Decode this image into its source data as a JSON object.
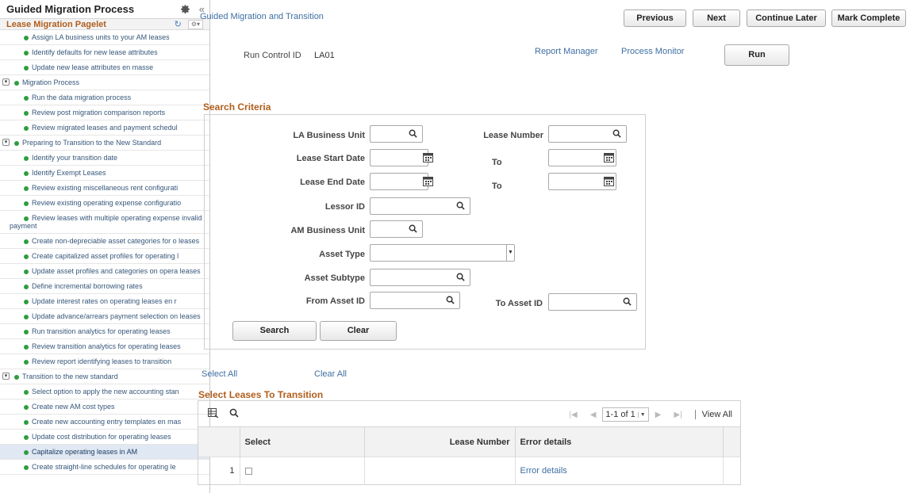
{
  "sidebar": {
    "title": "Guided Migration Process",
    "pagelet_title": "Lease Migration Pagelet",
    "items": [
      {
        "label": "Assign LA business units to your AM leases",
        "type": "step"
      },
      {
        "label": "Identify defaults for new lease attributes",
        "type": "step"
      },
      {
        "label": "Update new lease attributes en masse",
        "type": "step"
      },
      {
        "label": "Migration Process",
        "type": "section"
      },
      {
        "label": "Run the data migration process",
        "type": "step"
      },
      {
        "label": "Review post migration comparison reports",
        "type": "step"
      },
      {
        "label": "Review migrated leases and payment schedul",
        "type": "step"
      },
      {
        "label": "Preparing to Transition to the New Standard",
        "type": "section"
      },
      {
        "label": "Identify your transition date",
        "type": "step"
      },
      {
        "label": "Identify Exempt Leases",
        "type": "step"
      },
      {
        "label": "Review existing miscellaneous rent configurati",
        "type": "step"
      },
      {
        "label": "Review existing operating expense configuratio",
        "type": "step"
      },
      {
        "label": "Review leases with multiple operating expense invalid payment",
        "type": "wrap"
      },
      {
        "label": "Create non-depreciable asset categories for o leases",
        "type": "wrap"
      },
      {
        "label": "Create capitalized asset profiles for operating l",
        "type": "step"
      },
      {
        "label": "Update asset profiles and categories on opera leases",
        "type": "wrap"
      },
      {
        "label": "Define incremental borrowing rates",
        "type": "step"
      },
      {
        "label": "Update interest rates on operating leases en r",
        "type": "step"
      },
      {
        "label": "Update advance/arrears payment selection on leases",
        "type": "wrap"
      },
      {
        "label": "Run transition analytics for operating leases",
        "type": "step"
      },
      {
        "label": "Review transition analytics for operating leases",
        "type": "step"
      },
      {
        "label": "Review report identifying leases to transition",
        "type": "step"
      },
      {
        "label": "Transition to the new standard",
        "type": "section"
      },
      {
        "label": "Select option to apply the new accounting stan",
        "type": "step"
      },
      {
        "label": "Create new AM cost types",
        "type": "step"
      },
      {
        "label": "Create new accounting entry templates en mas",
        "type": "step"
      },
      {
        "label": "Update cost distribution for operating leases",
        "type": "step"
      },
      {
        "label": "Capitalize operating leases in AM",
        "type": "active"
      },
      {
        "label": "Create straight-line schedules for operating le",
        "type": "step"
      }
    ]
  },
  "header": {
    "title": "Guided Migration and Transition",
    "buttons": {
      "previous": "Previous",
      "next": "Next",
      "continue_later": "Continue Later",
      "mark_complete": "Mark Complete"
    }
  },
  "run_control": {
    "label": "Run Control ID",
    "value": "LA01",
    "report_manager": "Report Manager",
    "process_monitor": "Process Monitor",
    "run": "Run"
  },
  "search": {
    "title": "Search Criteria",
    "la_business_unit": "LA Business Unit",
    "lease_number": "Lease Number",
    "lease_start_date": "Lease Start Date",
    "lease_end_date": "Lease End Date",
    "to": "To",
    "lessor_id": "Lessor ID",
    "am_business_unit": "AM Business Unit",
    "asset_type": "Asset Type",
    "asset_subtype": "Asset Subtype",
    "from_asset_id": "From Asset ID",
    "to_asset_id": "To Asset ID",
    "search_button": "Search",
    "clear_button": "Clear"
  },
  "selection": {
    "select_all": "Select All",
    "clear_all": "Clear All",
    "grid_title": "Select Leases To Transition"
  },
  "grid": {
    "pager": "1-1 of 1",
    "view_all": "View All",
    "columns": {
      "select": "Select",
      "lease_number": "Lease Number",
      "error_details": "Error details"
    },
    "rows": [
      {
        "num": "1",
        "lease_number": "",
        "error_details": "Error details"
      }
    ]
  },
  "colors": {
    "link": "#3e6fa3",
    "section_orange": "#b05e1c",
    "status_green": "#2e9d3f"
  }
}
